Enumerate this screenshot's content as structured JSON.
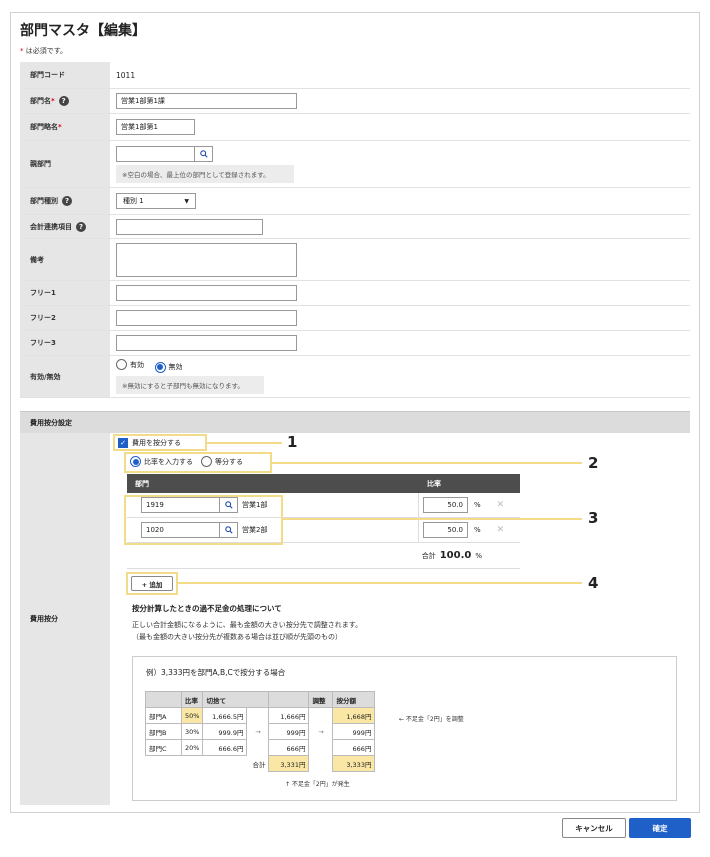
{
  "page": {
    "title": "部門マスタ【編集】",
    "required_note": "は必須です。",
    "required_mark": "*"
  },
  "form": {
    "code": {
      "label": "部門コード",
      "value": "1011"
    },
    "name": {
      "label": "部門名",
      "value": "営業1部第1課"
    },
    "short_name": {
      "label": "部門略名",
      "value": "営業1部第1"
    },
    "parent": {
      "label": "親部門",
      "value": "",
      "hint": "※空白の場合、最上位の部門として登録されます。"
    },
    "type": {
      "label": "部門種別",
      "value": "種別 1"
    },
    "accounting": {
      "label": "会計連携項目",
      "value": ""
    },
    "remarks": {
      "label": "備考",
      "value": ""
    },
    "free1": {
      "label": "フリー1",
      "value": ""
    },
    "free2": {
      "label": "フリー2",
      "value": ""
    },
    "free3": {
      "label": "フリー3",
      "value": ""
    },
    "valid": {
      "label": "有効/無効",
      "options": [
        "有効",
        "無効"
      ],
      "selected": "無効",
      "hint": "※無効にすると子部門も無効になります。"
    }
  },
  "allocation": {
    "section_title": "費用按分設定",
    "label": "費用按分",
    "checkbox_label": "費用を按分する",
    "method_options": [
      "比率を入力する",
      "等分する"
    ],
    "method_selected": "比率を入力する",
    "table_headers": [
      "部門",
      "比率"
    ],
    "rows": [
      {
        "code": "1919",
        "name": "営業1部",
        "rate": "50.0",
        "unit": "%"
      },
      {
        "code": "1020",
        "name": "営業2部",
        "rate": "50.0",
        "unit": "%"
      }
    ],
    "total_label": "合計",
    "total_value": "100.0",
    "total_unit": "%",
    "add_button": "+ 追加",
    "callouts": [
      "1",
      "2",
      "3",
      "4"
    ],
    "note_title": "按分計算したときの過不足金の処理について",
    "note_line1": "正しい合計金額になるように、最も金額の大きい按分先で調整されます。",
    "note_line2": "（最も金額の大きい按分先が複数ある場合は並び順が先頭のもの）",
    "example": {
      "title": "例）3,333円を部門A,B,Cで按分する場合",
      "headers": [
        "比率",
        "切捨て",
        "調整",
        "按分額"
      ],
      "rows": [
        {
          "dept": "部門A",
          "ratio": "50%",
          "raw": "1,666.5円",
          "trunc": "1,666円",
          "result": "1,668円"
        },
        {
          "dept": "部門B",
          "ratio": "30%",
          "raw": "999.9円",
          "trunc": "999円",
          "result": "999円"
        },
        {
          "dept": "部門C",
          "ratio": "20%",
          "raw": "666.6円",
          "trunc": "666円",
          "result": "666円"
        }
      ],
      "total_label": "合計",
      "total_trunc": "3,331円",
      "total_result": "3,333円",
      "adjust_note": "← 不足金「2円」を調整",
      "occur_note": "↑ 不足金「2円」が発生",
      "arrow": "→"
    }
  },
  "footer": {
    "cancel": "キャンセル",
    "confirm": "確定"
  }
}
